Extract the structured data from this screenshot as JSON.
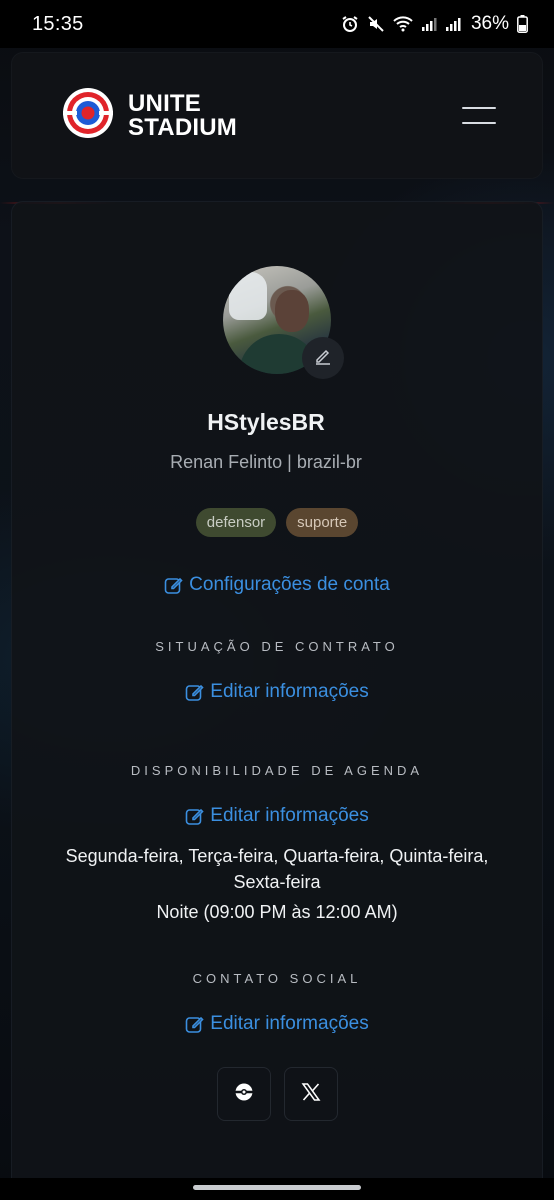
{
  "status_bar": {
    "time": "15:35",
    "battery": "36%",
    "icons": [
      "alarm-icon",
      "mute-icon",
      "wifi-icon",
      "signal-icon",
      "signal-r-icon",
      "battery-icon"
    ]
  },
  "header": {
    "logo_line1": "UNITE",
    "logo_line2": "STADIUM"
  },
  "profile": {
    "username": "HStylesBR",
    "realname": "Renan Felinto | brazil-br",
    "roles": [
      "defensor",
      "suporte"
    ],
    "account_settings_label": "Configurações de conta"
  },
  "contract": {
    "title": "SITUAÇÃO DE CONTRATO",
    "edit_label": "Editar informações"
  },
  "availability": {
    "title": "DISPONIBILIDADE DE AGENDA",
    "edit_label": "Editar informações",
    "days": "Segunda-feira, Terça-feira, Quarta-feira, Quinta-feira, Sexta-feira",
    "time": "Noite (09:00 PM às 12:00 AM)"
  },
  "social": {
    "title": "CONTATO SOCIAL",
    "edit_label": "Editar informações",
    "buttons": [
      "pokeball-icon",
      "x-icon"
    ]
  },
  "colors": {
    "link": "#3b8fe0",
    "badge_defensor": "#3f4a30",
    "badge_suporte": "#5a4630",
    "logo_red": "#e0242a",
    "logo_blue": "#1e5bd6"
  }
}
